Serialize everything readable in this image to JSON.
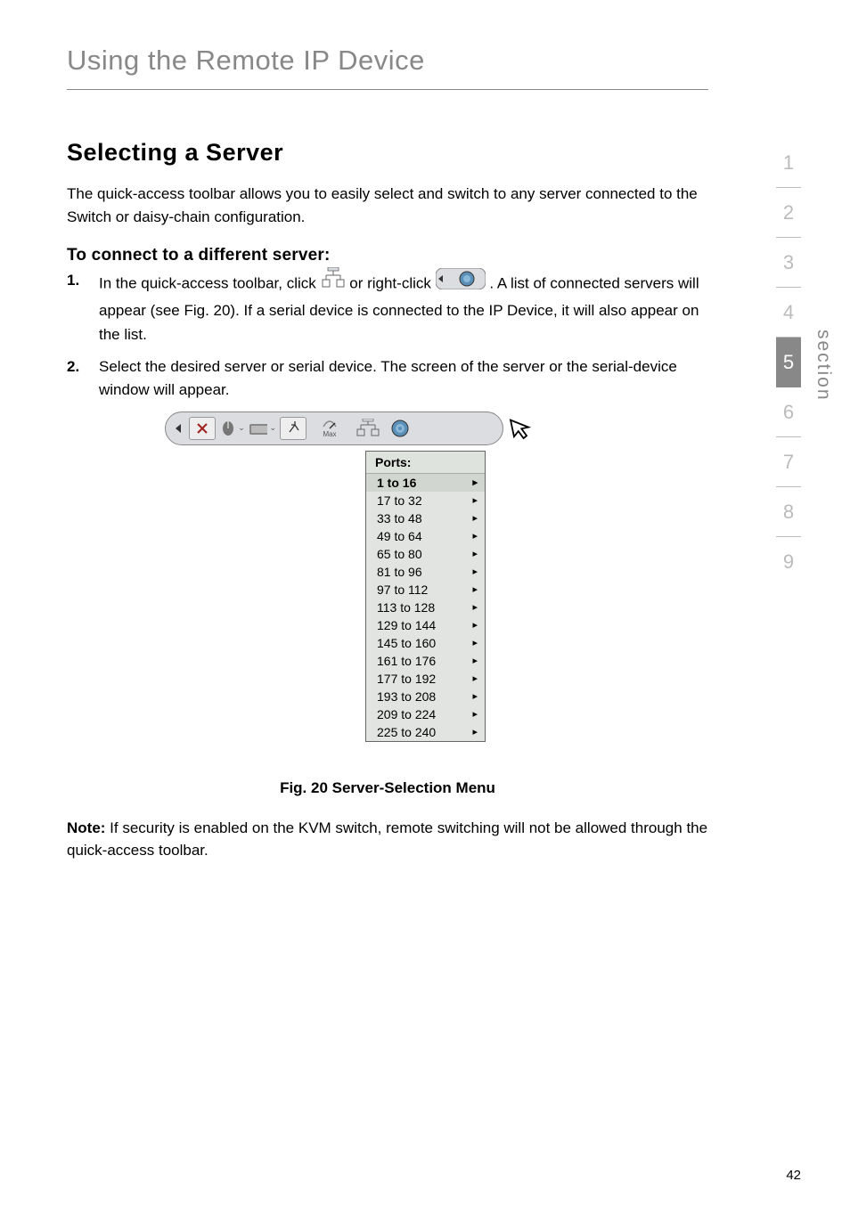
{
  "chapter": {
    "title": "Using the Remote IP Device"
  },
  "section": {
    "title": "Selecting a Server"
  },
  "intro": "The quick-access toolbar allows you to easily select and switch to any server connected to the Switch or daisy-chain configuration.",
  "subsection": {
    "title": "To connect to a different server:"
  },
  "steps": [
    {
      "num": "1.",
      "pre": "In the quick-access toolbar, click ",
      "mid": " or right-click ",
      "post": ". A list of connected servers will appear (see Fig. 20). If a serial device is connected to the IP Device, it will also appear on the list."
    },
    {
      "num": "2.",
      "text": "Select the desired server or serial device. The screen of the server or the serial-device window will appear."
    }
  ],
  "figure": {
    "caption": "Fig. 20 Server-Selection Menu",
    "menu_title": "Ports:",
    "menu_items": [
      {
        "label": "1 to 16",
        "selected": true
      },
      {
        "label": "17 to 32"
      },
      {
        "label": "33 to 48"
      },
      {
        "label": "49 to 64"
      },
      {
        "label": "65 to 80"
      },
      {
        "label": "81 to 96"
      },
      {
        "label": "97 to 112"
      },
      {
        "label": "113 to 128"
      },
      {
        "label": "129 to 144"
      },
      {
        "label": "145 to 160"
      },
      {
        "label": "161 to 176"
      },
      {
        "label": "177 to 192"
      },
      {
        "label": "193 to 208"
      },
      {
        "label": "209 to 224"
      },
      {
        "label": "225 to 240"
      }
    ],
    "toolbar_max": "Max"
  },
  "note": {
    "label": "Note:",
    "text": " If security is enabled on the KVM switch, remote switching will not be allowed through the quick-access toolbar."
  },
  "sidenav": {
    "items": [
      "1",
      "2",
      "3",
      "4",
      "5",
      "6",
      "7",
      "8",
      "9"
    ],
    "active_index": 4,
    "label": "section"
  },
  "page_number": "42"
}
